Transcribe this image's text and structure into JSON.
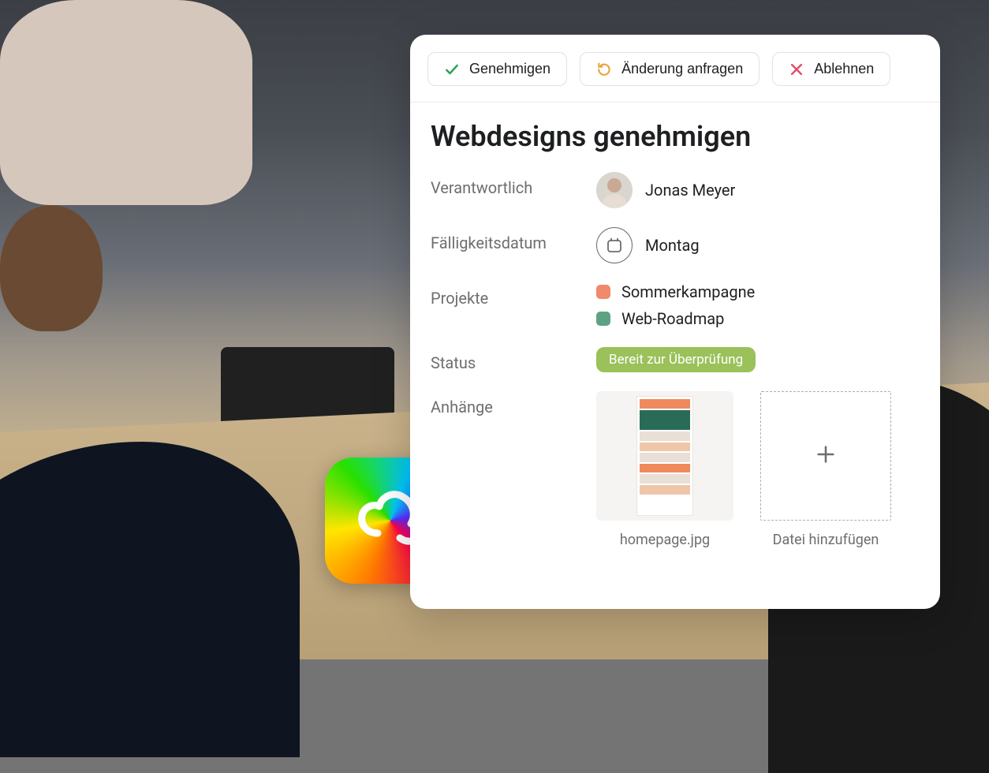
{
  "actions": {
    "approve": "Genehmigen",
    "request_change": "Änderung anfragen",
    "reject": "Ablehnen"
  },
  "task": {
    "title": "Webdesigns genehmigen",
    "fields": {
      "responsible_label": "Verantwortlich",
      "responsible_value": "Jonas Meyer",
      "due_label": "Fälligkeitsdatum",
      "due_value": "Montag",
      "projects_label": "Projekte",
      "projects": {
        "p0": "Sommerkampagne",
        "p1": "Web-Roadmap"
      },
      "status_label": "Status",
      "status_value": "Bereit zur Überprüfung",
      "attachments_label": "Anhänge",
      "attachment_filename": "homepage.jpg",
      "add_file_label": "Datei hinzufügen"
    }
  }
}
